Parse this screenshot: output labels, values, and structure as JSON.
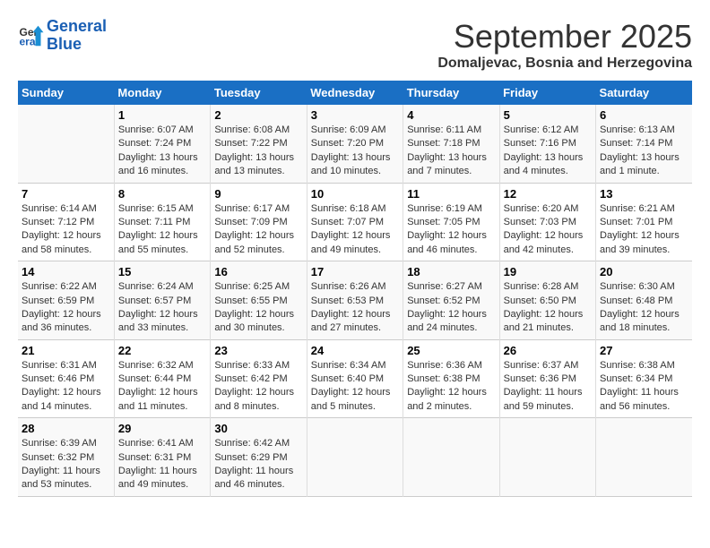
{
  "logo": {
    "line1": "General",
    "line2": "Blue"
  },
  "title": "September 2025",
  "subtitle": "Domaljevac, Bosnia and Herzegovina",
  "days_of_week": [
    "Sunday",
    "Monday",
    "Tuesday",
    "Wednesday",
    "Thursday",
    "Friday",
    "Saturday"
  ],
  "weeks": [
    [
      {
        "day": "",
        "sunrise": "",
        "sunset": "",
        "daylight": ""
      },
      {
        "day": "1",
        "sunrise": "Sunrise: 6:07 AM",
        "sunset": "Sunset: 7:24 PM",
        "daylight": "Daylight: 13 hours and 16 minutes."
      },
      {
        "day": "2",
        "sunrise": "Sunrise: 6:08 AM",
        "sunset": "Sunset: 7:22 PM",
        "daylight": "Daylight: 13 hours and 13 minutes."
      },
      {
        "day": "3",
        "sunrise": "Sunrise: 6:09 AM",
        "sunset": "Sunset: 7:20 PM",
        "daylight": "Daylight: 13 hours and 10 minutes."
      },
      {
        "day": "4",
        "sunrise": "Sunrise: 6:11 AM",
        "sunset": "Sunset: 7:18 PM",
        "daylight": "Daylight: 13 hours and 7 minutes."
      },
      {
        "day": "5",
        "sunrise": "Sunrise: 6:12 AM",
        "sunset": "Sunset: 7:16 PM",
        "daylight": "Daylight: 13 hours and 4 minutes."
      },
      {
        "day": "6",
        "sunrise": "Sunrise: 6:13 AM",
        "sunset": "Sunset: 7:14 PM",
        "daylight": "Daylight: 13 hours and 1 minute."
      }
    ],
    [
      {
        "day": "7",
        "sunrise": "Sunrise: 6:14 AM",
        "sunset": "Sunset: 7:12 PM",
        "daylight": "Daylight: 12 hours and 58 minutes."
      },
      {
        "day": "8",
        "sunrise": "Sunrise: 6:15 AM",
        "sunset": "Sunset: 7:11 PM",
        "daylight": "Daylight: 12 hours and 55 minutes."
      },
      {
        "day": "9",
        "sunrise": "Sunrise: 6:17 AM",
        "sunset": "Sunset: 7:09 PM",
        "daylight": "Daylight: 12 hours and 52 minutes."
      },
      {
        "day": "10",
        "sunrise": "Sunrise: 6:18 AM",
        "sunset": "Sunset: 7:07 PM",
        "daylight": "Daylight: 12 hours and 49 minutes."
      },
      {
        "day": "11",
        "sunrise": "Sunrise: 6:19 AM",
        "sunset": "Sunset: 7:05 PM",
        "daylight": "Daylight: 12 hours and 46 minutes."
      },
      {
        "day": "12",
        "sunrise": "Sunrise: 6:20 AM",
        "sunset": "Sunset: 7:03 PM",
        "daylight": "Daylight: 12 hours and 42 minutes."
      },
      {
        "day": "13",
        "sunrise": "Sunrise: 6:21 AM",
        "sunset": "Sunset: 7:01 PM",
        "daylight": "Daylight: 12 hours and 39 minutes."
      }
    ],
    [
      {
        "day": "14",
        "sunrise": "Sunrise: 6:22 AM",
        "sunset": "Sunset: 6:59 PM",
        "daylight": "Daylight: 12 hours and 36 minutes."
      },
      {
        "day": "15",
        "sunrise": "Sunrise: 6:24 AM",
        "sunset": "Sunset: 6:57 PM",
        "daylight": "Daylight: 12 hours and 33 minutes."
      },
      {
        "day": "16",
        "sunrise": "Sunrise: 6:25 AM",
        "sunset": "Sunset: 6:55 PM",
        "daylight": "Daylight: 12 hours and 30 minutes."
      },
      {
        "day": "17",
        "sunrise": "Sunrise: 6:26 AM",
        "sunset": "Sunset: 6:53 PM",
        "daylight": "Daylight: 12 hours and 27 minutes."
      },
      {
        "day": "18",
        "sunrise": "Sunrise: 6:27 AM",
        "sunset": "Sunset: 6:52 PM",
        "daylight": "Daylight: 12 hours and 24 minutes."
      },
      {
        "day": "19",
        "sunrise": "Sunrise: 6:28 AM",
        "sunset": "Sunset: 6:50 PM",
        "daylight": "Daylight: 12 hours and 21 minutes."
      },
      {
        "day": "20",
        "sunrise": "Sunrise: 6:30 AM",
        "sunset": "Sunset: 6:48 PM",
        "daylight": "Daylight: 12 hours and 18 minutes."
      }
    ],
    [
      {
        "day": "21",
        "sunrise": "Sunrise: 6:31 AM",
        "sunset": "Sunset: 6:46 PM",
        "daylight": "Daylight: 12 hours and 14 minutes."
      },
      {
        "day": "22",
        "sunrise": "Sunrise: 6:32 AM",
        "sunset": "Sunset: 6:44 PM",
        "daylight": "Daylight: 12 hours and 11 minutes."
      },
      {
        "day": "23",
        "sunrise": "Sunrise: 6:33 AM",
        "sunset": "Sunset: 6:42 PM",
        "daylight": "Daylight: 12 hours and 8 minutes."
      },
      {
        "day": "24",
        "sunrise": "Sunrise: 6:34 AM",
        "sunset": "Sunset: 6:40 PM",
        "daylight": "Daylight: 12 hours and 5 minutes."
      },
      {
        "day": "25",
        "sunrise": "Sunrise: 6:36 AM",
        "sunset": "Sunset: 6:38 PM",
        "daylight": "Daylight: 12 hours and 2 minutes."
      },
      {
        "day": "26",
        "sunrise": "Sunrise: 6:37 AM",
        "sunset": "Sunset: 6:36 PM",
        "daylight": "Daylight: 11 hours and 59 minutes."
      },
      {
        "day": "27",
        "sunrise": "Sunrise: 6:38 AM",
        "sunset": "Sunset: 6:34 PM",
        "daylight": "Daylight: 11 hours and 56 minutes."
      }
    ],
    [
      {
        "day": "28",
        "sunrise": "Sunrise: 6:39 AM",
        "sunset": "Sunset: 6:32 PM",
        "daylight": "Daylight: 11 hours and 53 minutes."
      },
      {
        "day": "29",
        "sunrise": "Sunrise: 6:41 AM",
        "sunset": "Sunset: 6:31 PM",
        "daylight": "Daylight: 11 hours and 49 minutes."
      },
      {
        "day": "30",
        "sunrise": "Sunrise: 6:42 AM",
        "sunset": "Sunset: 6:29 PM",
        "daylight": "Daylight: 11 hours and 46 minutes."
      },
      {
        "day": "",
        "sunrise": "",
        "sunset": "",
        "daylight": ""
      },
      {
        "day": "",
        "sunrise": "",
        "sunset": "",
        "daylight": ""
      },
      {
        "day": "",
        "sunrise": "",
        "sunset": "",
        "daylight": ""
      },
      {
        "day": "",
        "sunrise": "",
        "sunset": "",
        "daylight": ""
      }
    ]
  ]
}
